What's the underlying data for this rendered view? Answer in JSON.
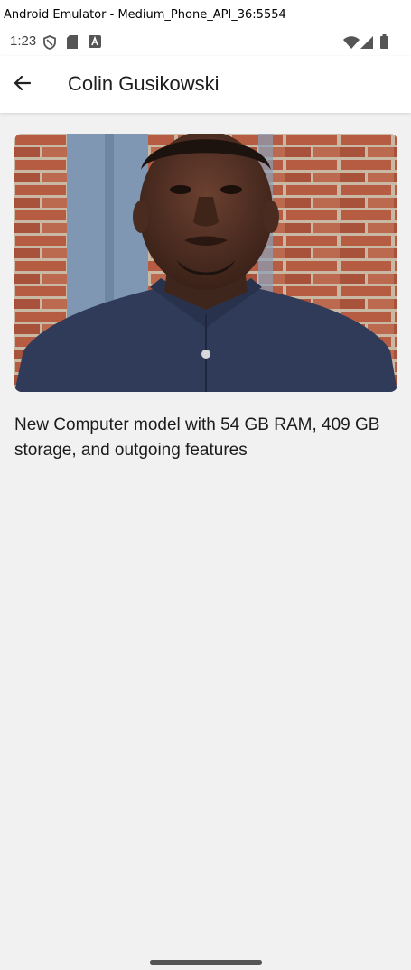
{
  "window": {
    "title": "Android Emulator - Medium_Phone_API_36:5554"
  },
  "status_bar": {
    "time": "1:23",
    "icons_left": [
      "shield-icon",
      "sd-card-icon",
      "font-a-icon"
    ],
    "icons_right": [
      "wifi-icon",
      "signal-icon",
      "battery-icon"
    ]
  },
  "app_bar": {
    "back_icon": "arrow-left-icon",
    "title": "Colin Gusikowski"
  },
  "content": {
    "photo_icon": "person-photo",
    "description": "New Computer model with 54 GB RAM, 409 GB storage, and outgoing features"
  },
  "colors": {
    "background": "#f1f1f1",
    "app_bar": "#ffffff",
    "text": "#1b1b1b"
  }
}
